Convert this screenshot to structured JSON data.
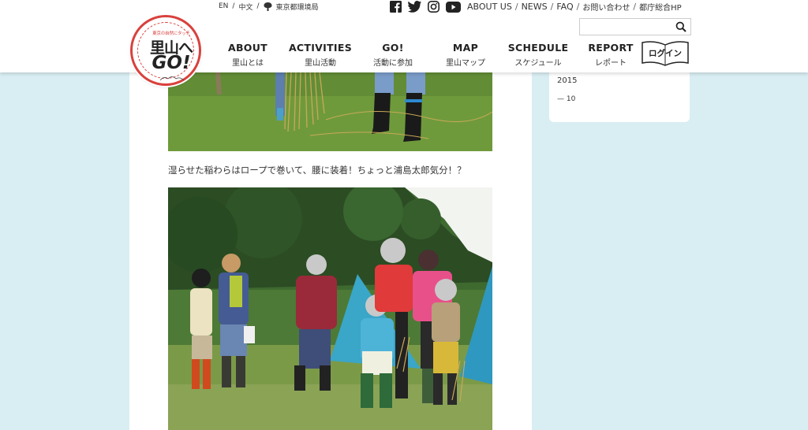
{
  "logo": {
    "tagline": "東京の自然にタッチ",
    "line1": "里山へ",
    "line2": "GO!"
  },
  "lang": {
    "en": "EN",
    "zh": "中文",
    "agency": "東京都環境局"
  },
  "topnav": {
    "about": "ABOUT US",
    "news": "NEWS",
    "faq": "FAQ",
    "contact": "お問い合わせ",
    "gov": "都庁総合HP"
  },
  "search": {
    "placeholder": ""
  },
  "nav": [
    {
      "en": "ABOUT",
      "ja": "里山とは"
    },
    {
      "en": "ACTIVITIES",
      "ja": "里山活動"
    },
    {
      "en": "GO!",
      "ja": "活動に参加"
    },
    {
      "en": "MAP",
      "ja": "里山マップ"
    },
    {
      "en": "SCHEDULE",
      "ja": "スケジュール"
    },
    {
      "en": "REPORT",
      "ja": "レポート"
    }
  ],
  "login": "ログイン",
  "article": {
    "caption": "湿らせた稲わらはロープで巻いて、腰に装着！ちょっと浦島太郎気分！？"
  },
  "sidebar": {
    "year": "2015",
    "month": "— 10"
  },
  "colors": {
    "accent": "#d9413d",
    "bg": "#d9eef3"
  }
}
